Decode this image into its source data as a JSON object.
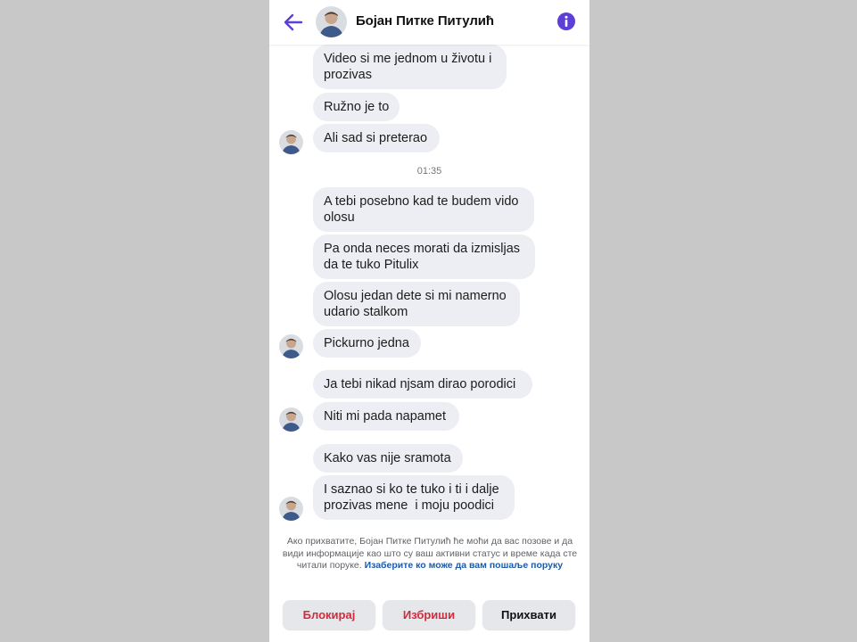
{
  "header": {
    "contact_name": "Бојан Питке Питулић",
    "back_icon": "arrow-left-icon",
    "info_icon": "info-circle-icon"
  },
  "messages": [
    {
      "lines": [
        "Video si me jednom u životu i",
        "prozivas"
      ]
    },
    {
      "lines": [
        "Ružno je to"
      ]
    },
    {
      "lines": [
        "Ali sad si preterao"
      ]
    },
    {
      "lines": [
        "A tebi posebno kad te budem vido",
        "olosu"
      ]
    },
    {
      "lines": [
        "Pa onda neces morati da izmisljas",
        "da te tuko Pitulix"
      ]
    },
    {
      "lines": [
        "Olosu jedan dete si mi namerno",
        "udario stalkom"
      ]
    },
    {
      "lines": [
        "Pickurno jedna"
      ]
    },
    {
      "lines": [
        "Ja tebi nikad njsam dirao porodici"
      ]
    },
    {
      "lines": [
        "Niti mi pada napamet"
      ]
    },
    {
      "lines": [
        "Kako vas nije sramota"
      ]
    },
    {
      "lines": [
        "I saznao si ko te tuko i ti i dalje",
        "prozivas mene  i moju poodici"
      ]
    }
  ],
  "timestamp": "01:35",
  "notice": {
    "text": "Ако прихватите, Бојан Питке Питулић ће моћи да вас позове и да види информације као што су ваш активни статус и време када сте читали поруке.",
    "link": "Изаберите ко може да вам пошаље поруку"
  },
  "actions": {
    "block": "Блокирај",
    "delete": "Избриши",
    "accept": "Прихвати"
  },
  "colors": {
    "accent": "#5b3fd6",
    "bubble": "#eceef3",
    "danger": "#d42a3c",
    "link": "#1d5aa8",
    "outside": "#c8c8c8"
  }
}
